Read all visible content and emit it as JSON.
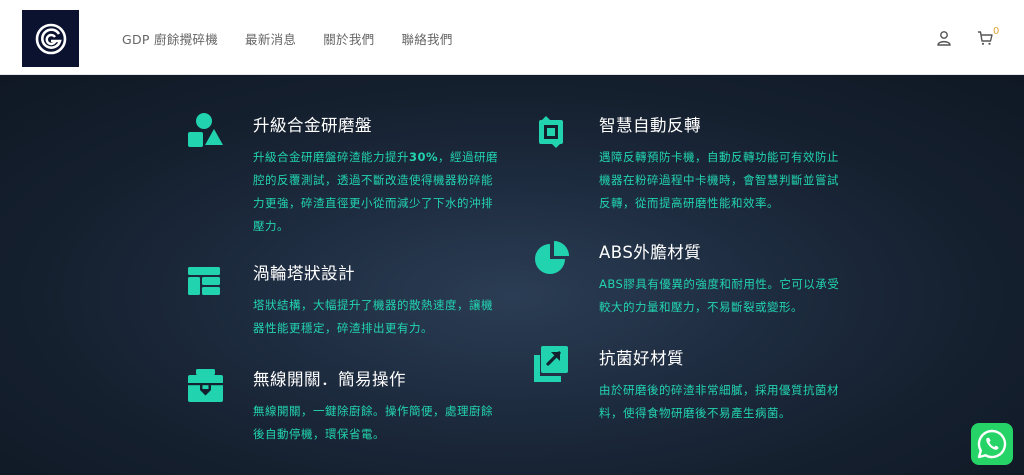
{
  "header": {
    "nav": [
      "GDP 廚餘攪碎機",
      "最新消息",
      "關於我們",
      "聯絡我們"
    ],
    "cart_count": "0"
  },
  "features": [
    {
      "title": "升級合金研磨盤",
      "desc_before": "升級合金研磨盤碎渣能力提升",
      "desc_bold": "30%",
      "desc_after": "，經過研磨腔的反覆測試，透過不斷改造使得機器粉碎能力更強，碎渣直徑更小從而減少了下水的沖排壓力。",
      "icon": "shapes-icon"
    },
    {
      "title": "渦輪塔狀設計",
      "desc": "塔狀結構，大幅提升了機器的散熱速度，讓機器性能更穩定，碎渣排出更有力。",
      "icon": "layout-icon"
    },
    {
      "title": "無線開關．簡易操作",
      "desc": "無線開關，一鍵除廚餘。操作簡便，處理廚餘後自動停機，環保省電。",
      "icon": "toolbox-icon"
    },
    {
      "title": "智慧自動反轉",
      "desc": "遇障反轉預防卡機，自動反轉功能可有效防止機器在粉碎過程中卡機時，會智慧判斷並嘗試反轉，從而提高研磨性能和效率。",
      "icon": "reverse-icon"
    },
    {
      "title": "ABS外膽材質",
      "desc": "ABS膠具有優異的強度和耐用性。它可以承受較大的力量和壓力，不易斷裂或變形。",
      "icon": "pie-chart-icon"
    },
    {
      "title": "抗菌好材質",
      "desc": "由於研磨後的碎渣非常細膩，採用優質抗菌材料，使得食物研磨後不易產生病菌。",
      "icon": "external-link-icon"
    }
  ],
  "colors": {
    "accent": "#22d3b0",
    "header_bg": "#ffffff",
    "logo_bg": "#0b1230",
    "hero_bg": "#15202f",
    "whatsapp": "#25d366",
    "cart_badge": "#e8a33d"
  }
}
